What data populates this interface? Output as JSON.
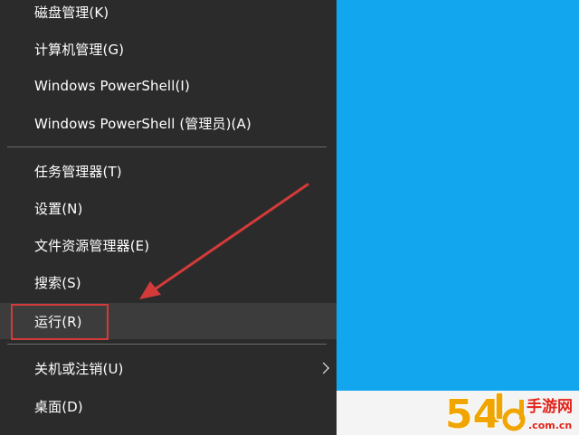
{
  "menu": {
    "items": [
      {
        "label": "磁盘管理(K)"
      },
      {
        "label": "计算机管理(G)"
      },
      {
        "label": "Windows PowerShell(I)"
      },
      {
        "label": "Windows PowerShell (管理员)(A)"
      },
      {
        "label": "任务管理器(T)"
      },
      {
        "label": "设置(N)"
      },
      {
        "label": "文件资源管理器(E)"
      },
      {
        "label": "搜索(S)"
      },
      {
        "label": "运行(R)"
      },
      {
        "label": "关机或注销(U)"
      },
      {
        "label": "桌面(D)"
      }
    ]
  },
  "watermark": {
    "digits": "54",
    "site": "手游网",
    "domain": ".com.cn"
  },
  "colors": {
    "menu_bg": "#2b2b2b",
    "desktop": "#12a6ee",
    "annotation": "#d43a3a"
  }
}
